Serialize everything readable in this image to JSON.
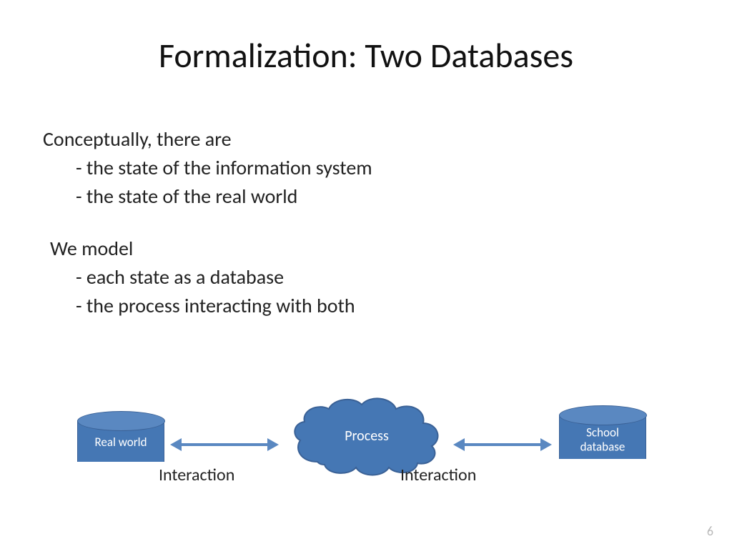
{
  "title": "Formalization: Two Databases",
  "body": {
    "lead1": "Conceptually, there are",
    "b1": "- the state of the information system",
    "b2": "- the state of the real world",
    "lead2": "We model",
    "b3": "- each state as a database",
    "b4": "- the process interacting with both"
  },
  "diagram": {
    "left_cyl": "Real world",
    "right_cyl": "School\ndatabase",
    "cloud": "Process",
    "arrow_left_caption": "Interaction",
    "arrow_right_caption": "Interaction"
  },
  "page_number": "6",
  "colors": {
    "shape_fill": "#4577b4",
    "shape_stroke": "#3a6196",
    "arrow": "#5a88c1"
  }
}
